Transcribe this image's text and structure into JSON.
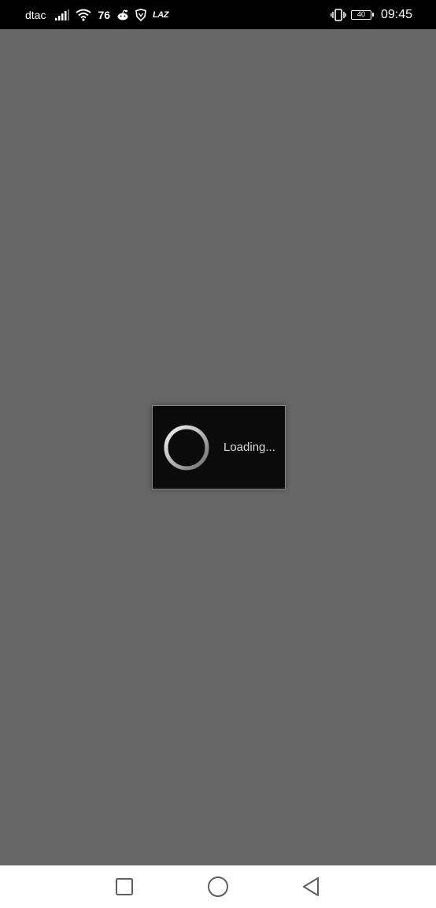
{
  "status_bar": {
    "carrier": "dtac",
    "network_count": "76",
    "app_badge": "LAZ",
    "battery_level": "40",
    "time": "09:45",
    "icons": [
      "signal-icon",
      "wifi-icon",
      "reddit-icon",
      "brave-icon",
      "lazada-icon",
      "vibrate-icon",
      "battery-icon"
    ]
  },
  "dialog": {
    "loading_text": "Loading..."
  },
  "nav_bar": {
    "icons": [
      "recents-icon",
      "home-icon",
      "back-icon"
    ]
  },
  "colors": {
    "overlay": "#666666",
    "status_bar_bg": "#000000",
    "dialog_bg": "#0b0b0b",
    "dialog_border": "#8a8a8a",
    "nav_bar_bg": "#ffffff",
    "nav_icon": "#5f5f5f"
  }
}
